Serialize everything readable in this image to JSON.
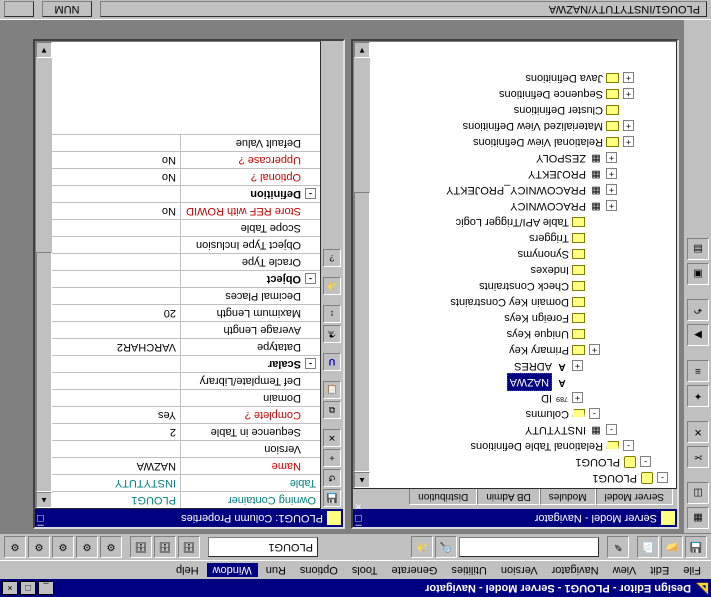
{
  "window": {
    "title": "Design Editor - PLOUG1 - Server Model - Navigator",
    "minimize": "_",
    "maximize": "□",
    "close": "×"
  },
  "menu": {
    "items": [
      "File",
      "Edit",
      "View",
      "Navigator",
      "Version",
      "Utilities",
      "Generate",
      "Tools",
      "Options",
      "Run",
      "Window",
      "Help"
    ],
    "active_index": 10
  },
  "main_toolbar": {
    "combo_value": "PLOUG1"
  },
  "left_child": {
    "title": "Server Model - Navigator",
    "tabs": [
      "Server Model",
      "Modules",
      "DB Admin",
      "Distribution"
    ],
    "active_tab": 0,
    "tree": [
      {
        "depth": 0,
        "exp": "-",
        "icon": "db",
        "label": "PLOUG1"
      },
      {
        "depth": 1,
        "exp": "-",
        "icon": "db",
        "label": "PLOUG1"
      },
      {
        "depth": 2,
        "exp": "-",
        "icon": "folder-open",
        "label": "Relational Table Definitions"
      },
      {
        "depth": 3,
        "exp": "-",
        "icon": "table",
        "label": "INSTYTUTY"
      },
      {
        "depth": 4,
        "exp": "-",
        "icon": "folder-open",
        "label": "Columns"
      },
      {
        "depth": 5,
        "exp": "+",
        "icon": "id",
        "label": "ID"
      },
      {
        "depth": 5,
        "exp": "",
        "icon": "A",
        "label": "NAZWA",
        "selected": true
      },
      {
        "depth": 5,
        "exp": "+",
        "icon": "A",
        "label": "ADRES"
      },
      {
        "depth": 4,
        "exp": "+",
        "icon": "folder",
        "label": "Primary Key"
      },
      {
        "depth": 4,
        "exp": "",
        "icon": "folder",
        "label": "Unique Keys"
      },
      {
        "depth": 4,
        "exp": "",
        "icon": "folder",
        "label": "Foreign Keys"
      },
      {
        "depth": 4,
        "exp": "",
        "icon": "folder",
        "label": "Domain Key Constraints"
      },
      {
        "depth": 4,
        "exp": "",
        "icon": "folder",
        "label": "Check Constraints"
      },
      {
        "depth": 4,
        "exp": "",
        "icon": "folder",
        "label": "Indexes"
      },
      {
        "depth": 4,
        "exp": "",
        "icon": "folder",
        "label": "Synonyms"
      },
      {
        "depth": 4,
        "exp": "",
        "icon": "folder",
        "label": "Triggers"
      },
      {
        "depth": 4,
        "exp": "",
        "icon": "folder",
        "label": "Table API/Trigger Logic"
      },
      {
        "depth": 3,
        "exp": "+",
        "icon": "table",
        "label": "PRACOWNICY"
      },
      {
        "depth": 3,
        "exp": "+",
        "icon": "table",
        "label": "PRACOWNICY_PROJEKTY"
      },
      {
        "depth": 3,
        "exp": "+",
        "icon": "table",
        "label": "PROJEKTY"
      },
      {
        "depth": 3,
        "exp": "+",
        "icon": "table",
        "label": "ZESPOLY"
      },
      {
        "depth": 2,
        "exp": "+",
        "icon": "folder",
        "label": "Relational View Definitions"
      },
      {
        "depth": 2,
        "exp": "+",
        "icon": "folder",
        "label": "Materialized View Definitions"
      },
      {
        "depth": 2,
        "exp": "",
        "icon": "folder",
        "label": "Cluster Definitions"
      },
      {
        "depth": 2,
        "exp": "+",
        "icon": "folder",
        "label": "Sequence Definitions"
      },
      {
        "depth": 2,
        "exp": "+",
        "icon": "folder",
        "label": "Java Definitions"
      }
    ]
  },
  "right_child": {
    "title": "PLOUG1: Column Properties",
    "rows": [
      {
        "type": "header",
        "name": "Owning Container",
        "value": "PLOUG1"
      },
      {
        "type": "header",
        "name": "Table",
        "value": "INSTYTUTY"
      },
      {
        "type": "required",
        "name": "Name",
        "value": "NAZWA"
      },
      {
        "type": "normal",
        "name": "Version",
        "value": ""
      },
      {
        "type": "normal",
        "name": "Sequence in Table",
        "value": "2"
      },
      {
        "type": "required",
        "name": "Complete ?",
        "value": "Yes"
      },
      {
        "type": "normal",
        "name": "Domain",
        "value": ""
      },
      {
        "type": "normal",
        "name": "Def Template/Library Obje",
        "value": ""
      },
      {
        "type": "section",
        "exp": "-",
        "name": "Scalar",
        "value": ""
      },
      {
        "type": "normal",
        "name": "Datatype",
        "value": "VARCHAR2"
      },
      {
        "type": "normal",
        "name": "Average Length",
        "value": ""
      },
      {
        "type": "normal",
        "name": "Maximum Length",
        "value": "20"
      },
      {
        "type": "normal",
        "name": "Decimal Places",
        "value": ""
      },
      {
        "type": "section",
        "exp": "-",
        "name": "Object",
        "value": ""
      },
      {
        "type": "normal",
        "name": "Oracle Type",
        "value": ""
      },
      {
        "type": "normal",
        "name": "Object Type Inclusion",
        "value": ""
      },
      {
        "type": "normal",
        "name": "Scope Table",
        "value": ""
      },
      {
        "type": "required",
        "name": "Store REF with ROWID",
        "value": "No"
      },
      {
        "type": "section",
        "exp": "-",
        "name": "Definition",
        "value": ""
      },
      {
        "type": "required",
        "name": "Optional ?",
        "value": "No"
      },
      {
        "type": "required",
        "name": "Uppercase ?",
        "value": "No"
      },
      {
        "type": "normal",
        "name": "Default Value",
        "value": ""
      }
    ]
  },
  "statusbar": {
    "path": "PLOUG1/INSTYTUTY/NAZWA",
    "num": "NUM"
  }
}
